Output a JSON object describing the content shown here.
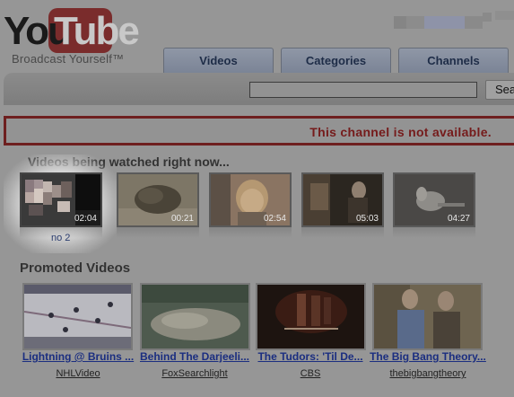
{
  "logo": {
    "you": "You",
    "tube": "Tube",
    "tagline": "Broadcast Yourself™"
  },
  "tabs": [
    {
      "label": "Videos"
    },
    {
      "label": "Categories"
    },
    {
      "label": "Channels"
    }
  ],
  "search": {
    "value": "",
    "button_label": "Search"
  },
  "notice": {
    "text": "This channel is not available."
  },
  "watching_now": {
    "title": "Videos being watched right now...",
    "items": [
      {
        "duration": "02:04",
        "label": "no 2"
      },
      {
        "duration": "00:21"
      },
      {
        "duration": "02:54"
      },
      {
        "duration": "05:03"
      },
      {
        "duration": "04:27"
      }
    ]
  },
  "promoted": {
    "title": "Promoted Videos",
    "items": [
      {
        "title": "Lightning @ Bruins ...",
        "channel": "NHLVideo"
      },
      {
        "title": "Behind The Darjeeli...",
        "channel": "FoxSearchlight"
      },
      {
        "title": "The Tudors: 'Til De...",
        "channel": "CBS"
      },
      {
        "title": "The Big Bang Theory...",
        "channel": "thebigbangtheory"
      }
    ]
  },
  "colors": {
    "background": "#969696",
    "notice_border": "#6e1f1f",
    "notice_text": "#751b1b",
    "link": "#1b2e80"
  }
}
